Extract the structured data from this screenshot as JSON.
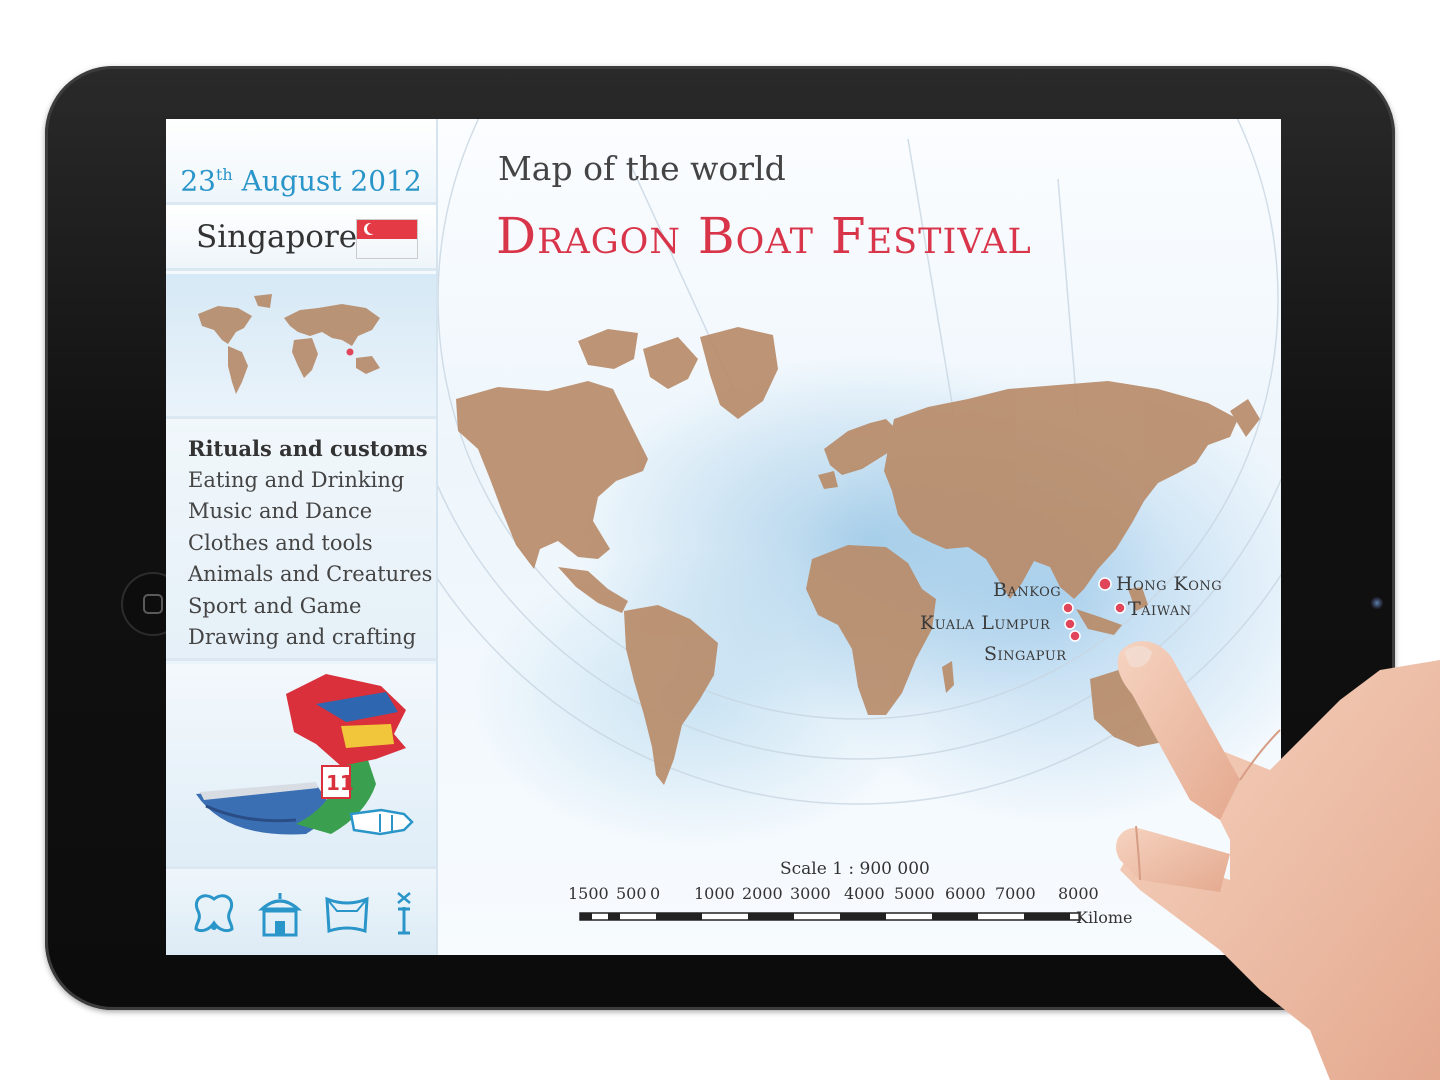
{
  "sidebar": {
    "date_day": "23",
    "date_suffix": "th",
    "date_rest": "August 2012",
    "city": "Singapore",
    "menu": [
      {
        "label": "Rituals and customs",
        "active": true
      },
      {
        "label": "Eating and Drinking",
        "active": false
      },
      {
        "label": "Music and Dance",
        "active": false
      },
      {
        "label": "Clothes and tools",
        "active": false
      },
      {
        "label": "Animals and Creatures",
        "active": false
      },
      {
        "label": "Sport and Game",
        "active": false
      },
      {
        "label": "Drawing and crafting",
        "active": false
      }
    ],
    "boat_number": "11",
    "icons": [
      "ornament-icon",
      "pavilion-icon",
      "pillow-icon",
      "info-icon"
    ]
  },
  "main": {
    "subtitle": "Map of the world",
    "title": "Dragon Boat Festival",
    "cities": [
      "Bankog",
      "Hong Kong",
      "Taiwan",
      "Kuala Lumpur",
      "Singapur"
    ],
    "scale": {
      "title": "Scale 1 : 900 000",
      "ticks": [
        "1500",
        "500",
        "0",
        "1000",
        "2000",
        "3000",
        "4000",
        "5000",
        "6000",
        "7000",
        "8000"
      ],
      "unit": "Kilome"
    }
  },
  "colors": {
    "accent_blue": "#2a95c8",
    "title_red": "#d9354a",
    "land": "#b98c6a",
    "marker": "#e0455a"
  }
}
